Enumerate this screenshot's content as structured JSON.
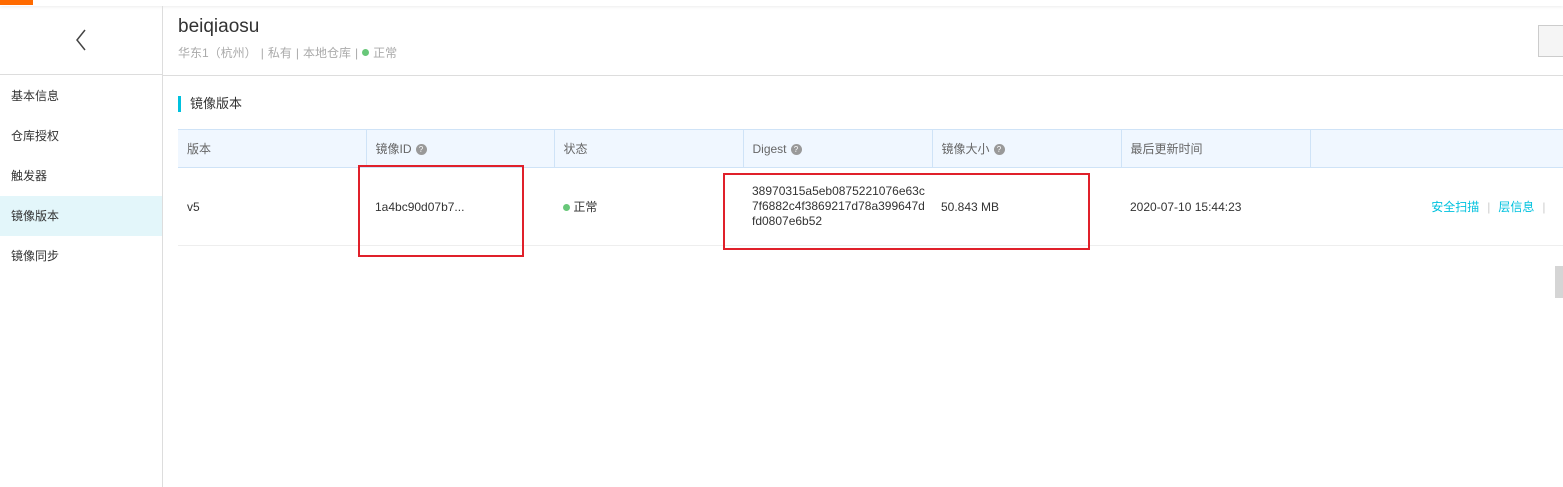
{
  "header": {
    "title": "beiqiaosu",
    "region": "华东1（杭州）",
    "visibility": "私有",
    "repo_type": "本地仓库",
    "status": "正常",
    "separator": "|"
  },
  "sidebar": {
    "items": [
      {
        "label": "基本信息"
      },
      {
        "label": "仓库授权"
      },
      {
        "label": "触发器"
      },
      {
        "label": "镜像版本",
        "active": true
      },
      {
        "label": "镜像同步"
      }
    ]
  },
  "section": {
    "title": "镜像版本"
  },
  "table": {
    "columns": [
      "版本",
      "镜像ID",
      "状态",
      "Digest",
      "镜像大小",
      "最后更新时间",
      ""
    ],
    "rows": [
      {
        "version": "v5",
        "image_id": "1a4bc90d07b7...",
        "status": "正常",
        "digest": [
          "38970315a5eb0875221076e63c",
          "7f6882c4f3869217d78a399647d",
          "fd0807e6b52"
        ],
        "size": "50.843 MB",
        "updated": "2020-07-10 15:44:23",
        "actions": [
          "安全扫描",
          "层信息"
        ]
      }
    ]
  },
  "colors": {
    "accent": "#00c1de",
    "brand": "#ff6a00",
    "status_ok": "#68c779",
    "highlight": "#e0202a"
  }
}
